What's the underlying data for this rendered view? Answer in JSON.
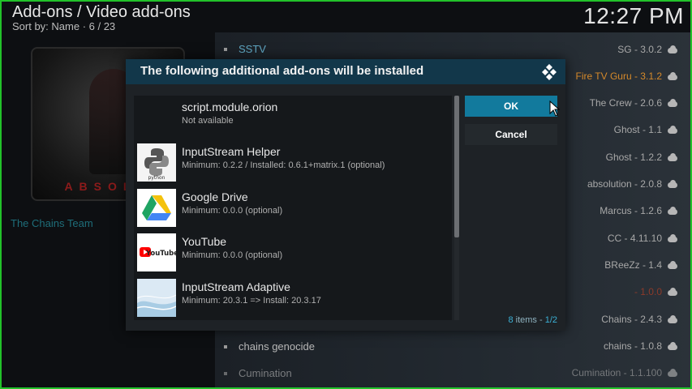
{
  "header": {
    "title": "Add-ons / Video add-ons",
    "sort": "Sort by: Name  ·  6 / 23"
  },
  "clock": "12:27 PM",
  "left_panel": {
    "team": "The Chains Team",
    "thumb_text": "ABSOLU"
  },
  "background_list": [
    {
      "name": "SSTV"
    },
    {
      "name": "chains genocide"
    },
    {
      "name": "Cumination"
    }
  ],
  "addons_right": [
    {
      "label": "SG - 3.0.2"
    },
    {
      "label": "Fire TV Guru - 3.1.2"
    },
    {
      "label": "The Crew - 2.0.6"
    },
    {
      "label": "Ghost - 1.1"
    },
    {
      "label": "Ghost - 1.2.2"
    },
    {
      "label": "absolution - 2.0.8"
    },
    {
      "label": "Marcus - 1.2.6"
    },
    {
      "label": "CC - 4.11.10"
    },
    {
      "label": "BReeZz - 1.4"
    },
    {
      "label": "- 1.0.0"
    },
    {
      "label": "Chains - 2.4.3"
    },
    {
      "label": "chains - 1.0.8"
    },
    {
      "label": "Cumination - 1.1.100"
    }
  ],
  "dialog": {
    "title": "The following additional add-ons will be installed",
    "items": [
      {
        "name": "script.module.orion",
        "desc": "Not available",
        "icon": "blank"
      },
      {
        "name": "InputStream Helper",
        "desc": "Minimum: 0.2.2 / Installed: 0.6.1+matrix.1 (optional)",
        "icon": "python-icon"
      },
      {
        "name": "Google Drive",
        "desc": "Minimum: 0.0.0 (optional)",
        "icon": "google-drive-icon"
      },
      {
        "name": "YouTube",
        "desc": "Minimum: 0.0.0 (optional)",
        "icon": "youtube-icon"
      },
      {
        "name": "InputStream Adaptive",
        "desc": "Minimum: 20.3.1 => Install: 20.3.17",
        "icon": "inputstream-icon"
      }
    ],
    "ok_label": "OK",
    "cancel_label": "Cancel",
    "count_items": "8",
    "count_items_suffix": " items - ",
    "count_page": "1/2"
  },
  "colors": {
    "header_bg": "#12374a",
    "ok_button": "#127a9d",
    "accent_text": "#3bb1d6",
    "frame": "#22c22a"
  }
}
